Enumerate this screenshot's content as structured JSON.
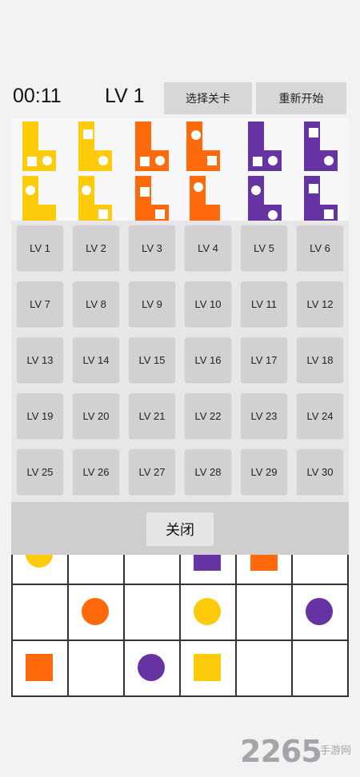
{
  "header": {
    "timer": "00:11",
    "level": "LV 1",
    "select_level_label": "选择关卡",
    "restart_label": "重新开始"
  },
  "colors": {
    "yellow": "#fecb0b",
    "orange": "#fe6a0b",
    "purple": "#6633a3"
  },
  "levels": [
    "LV 1",
    "LV 2",
    "LV 3",
    "LV 4",
    "LV 5",
    "LV 6",
    "LV 7",
    "LV 8",
    "LV 9",
    "LV 10",
    "LV 11",
    "LV 12",
    "LV 13",
    "LV 14",
    "LV 15",
    "LV 16",
    "LV 17",
    "LV 18",
    "LV 19",
    "LV 20",
    "LV 21",
    "LV 22",
    "LV 23",
    "LV 24",
    "LV 25",
    "LV 26",
    "LV 27",
    "LV 28",
    "LV 29",
    "LV 30"
  ],
  "close_label": "关闭",
  "watermark": {
    "number": "2265",
    "site": "手游网"
  }
}
